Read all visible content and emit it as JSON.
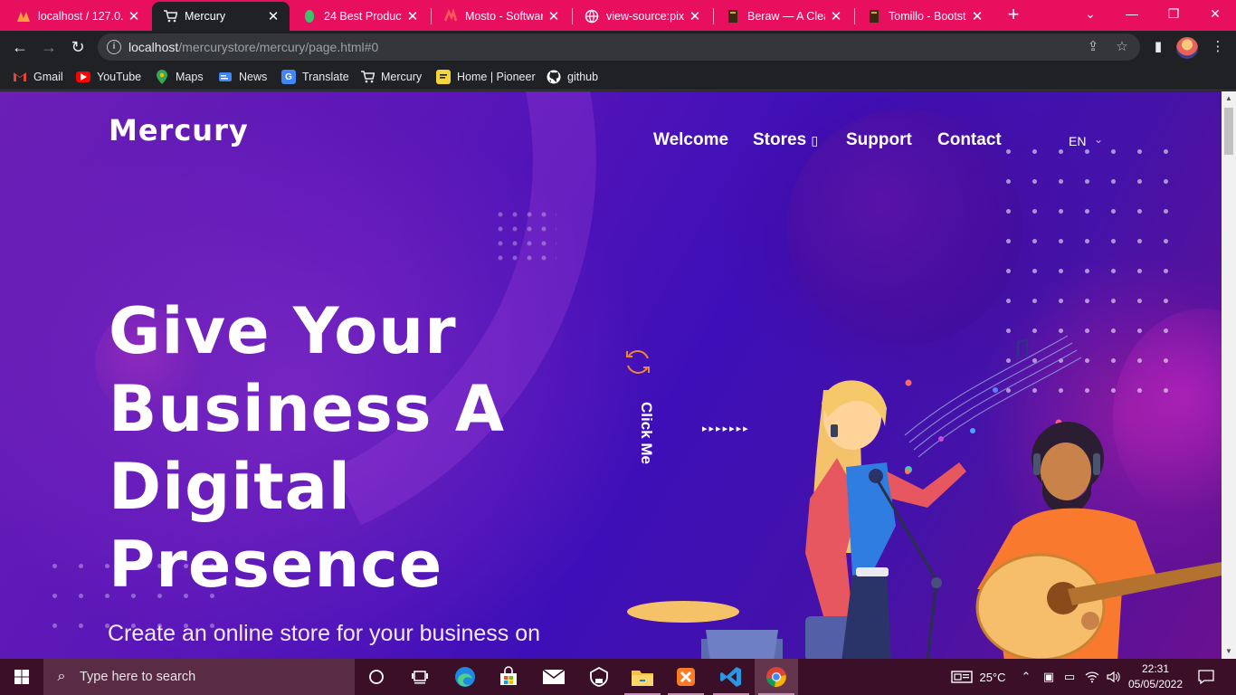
{
  "browser": {
    "tabs": [
      {
        "title": "localhost / 127.0.0",
        "active": false,
        "icon": "phpmyadmin-icon"
      },
      {
        "title": "Mercury",
        "active": true,
        "icon": "cart-icon"
      },
      {
        "title": "24 Best Product La",
        "active": false,
        "icon": "leaf-icon"
      },
      {
        "title": "Mosto - Software a",
        "active": false,
        "icon": "mosto-icon"
      },
      {
        "title": "view-source:pixne",
        "active": false,
        "icon": "globe-icon"
      },
      {
        "title": "Beraw — A Clean",
        "active": false,
        "icon": "book-icon"
      },
      {
        "title": "Tomillo - Bootstra",
        "active": false,
        "icon": "book-icon"
      }
    ],
    "url": {
      "host": "localhost",
      "path": "/mercurystore/mercury/page.html#0"
    },
    "bookmarks": [
      {
        "label": "Gmail",
        "icon": "gmail-icon"
      },
      {
        "label": "YouTube",
        "icon": "youtube-icon"
      },
      {
        "label": "Maps",
        "icon": "maps-icon"
      },
      {
        "label": "News",
        "icon": "news-icon"
      },
      {
        "label": "Translate",
        "icon": "translate-icon"
      },
      {
        "label": "Mercury",
        "icon": "cart-icon"
      },
      {
        "label": "Home | Pioneer",
        "icon": "pioneer-icon"
      },
      {
        "label": "github",
        "icon": "github-icon"
      }
    ],
    "accent": "#e8105e"
  },
  "page": {
    "logo": "Mercury",
    "nav": {
      "welcome": "Welcome",
      "stores": "Stores ",
      "stores_glyph": "▯",
      "support": "Support",
      "contact": "Contact",
      "lang": "EN"
    },
    "hero": {
      "lines": [
        "Give Your",
        "Business A",
        "Digital",
        "Presence"
      ],
      "subtitle": "Create an online store for your business on"
    },
    "cta": {
      "label": "Click Me",
      "arrows": "▸▸▸▸▸▸▸"
    }
  },
  "taskbar": {
    "search_placeholder": "Type here to search",
    "weather": "25°C",
    "time": "22:31",
    "date": "05/05/2022"
  }
}
